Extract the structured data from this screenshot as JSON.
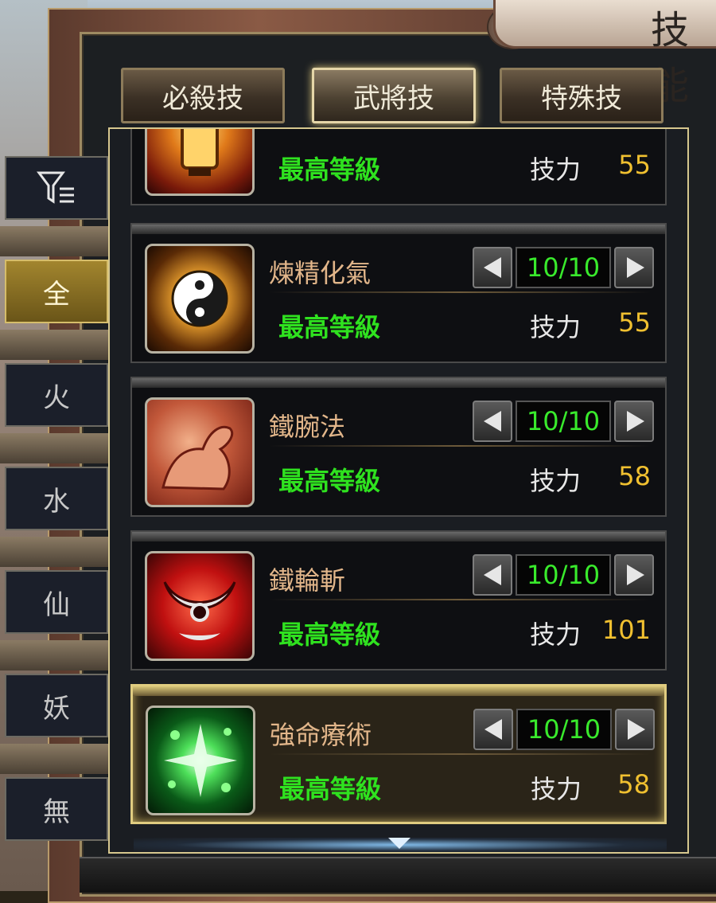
{
  "header": {
    "title": "技能"
  },
  "tabs": [
    {
      "label": "必殺技",
      "active": false
    },
    {
      "label": "武將技",
      "active": true
    },
    {
      "label": "特殊技",
      "active": false
    }
  ],
  "filters": {
    "filter_icon": "filter-list-icon",
    "items": [
      {
        "label": "全",
        "active": true
      },
      {
        "label": "火",
        "active": false
      },
      {
        "label": "水",
        "active": false
      },
      {
        "label": "仙",
        "active": false
      },
      {
        "label": "妖",
        "active": false
      },
      {
        "label": "無",
        "active": false
      }
    ]
  },
  "skills": [
    {
      "name": "",
      "icon": "lantern-icon",
      "level": "",
      "max_label": "最高等級",
      "cost_label": "技力",
      "cost": "55",
      "partial": true
    },
    {
      "name": "煉精化氣",
      "icon": "yin-yang-icon",
      "level": "10/10",
      "max_label": "最高等級",
      "cost_label": "技力",
      "cost": "55"
    },
    {
      "name": "鐵腕法",
      "icon": "muscle-arm-icon",
      "level": "10/10",
      "max_label": "最高等級",
      "cost_label": "技力",
      "cost": "58"
    },
    {
      "name": "鐵輪斬",
      "icon": "crescent-blade-icon",
      "level": "10/10",
      "max_label": "最高等級",
      "cost_label": "技力",
      "cost": "101"
    },
    {
      "name": "強命療術",
      "icon": "green-sparkle-icon",
      "level": "10/10",
      "max_label": "最高等級",
      "cost_label": "技力",
      "cost": "58",
      "selected": true
    }
  ],
  "colors": {
    "max_level_text": "#2fe21f",
    "cost_value": "#f0c030",
    "skill_name": "#e2b68a",
    "selected_border": "#e0cc80"
  }
}
